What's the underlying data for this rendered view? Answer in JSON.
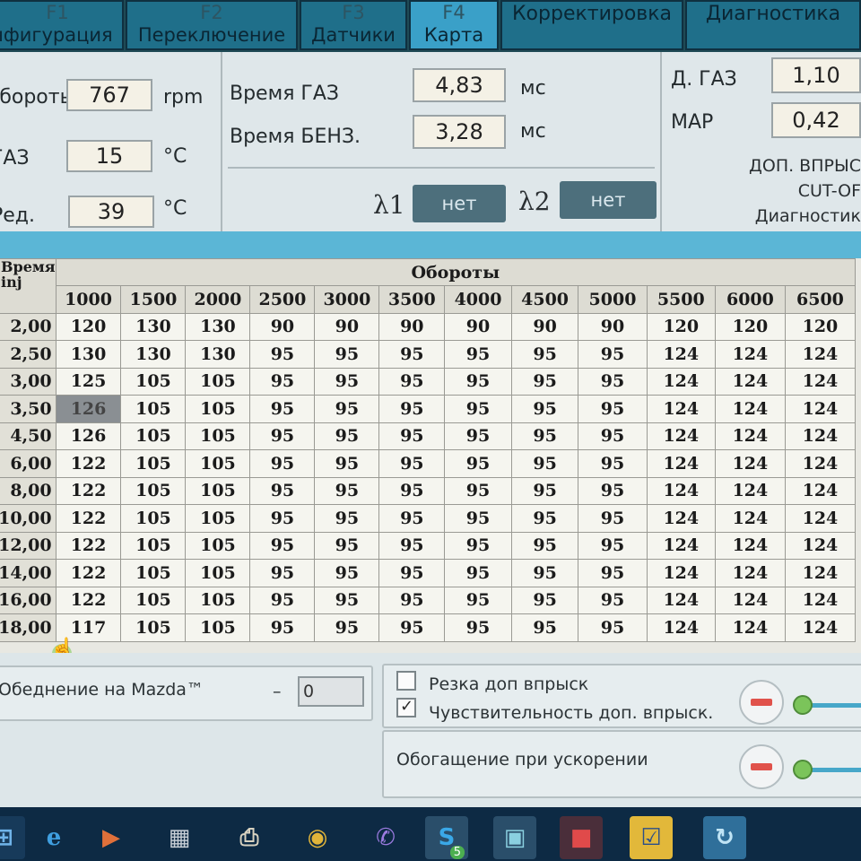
{
  "tabs": [
    {
      "key": "F1",
      "label": "Конфигурация"
    },
    {
      "key": "F2",
      "label": "Переключение"
    },
    {
      "key": "F3",
      "label": "Датчики"
    },
    {
      "key": "F4",
      "label": "Карта"
    },
    {
      "key": "",
      "label": "Корректировка"
    },
    {
      "key": "",
      "label": "Диагностика"
    }
  ],
  "info": {
    "rpm_label": "Обороты",
    "rpm_value": "767",
    "rpm_unit": "rpm",
    "gas_label": "ГАЗ",
    "gas_value": "15",
    "gas_unit": "°C",
    "red_label": "Ред.",
    "red_value": "39",
    "red_unit": "°C",
    "time_gas_label": "Время ГАЗ",
    "time_gas_value": "4,83",
    "time_gas_unit": "мс",
    "time_benz_label": "Время БЕНЗ.",
    "time_benz_value": "3,28",
    "time_benz_unit": "мс",
    "lambda1_label": "λ1",
    "lambda1_value": "нет",
    "lambda2_label": "λ2",
    "lambda2_value": "нет",
    "d_gas_label": "Д. ГАЗ",
    "d_gas_value": "1,10",
    "map_label": "MAP",
    "map_value": "0,42",
    "status_1": "ДОП. ВПРЫС",
    "status_2": "CUT-OF",
    "status_3": "Диагностик"
  },
  "table": {
    "title": "Обороты",
    "corner_1": "Время",
    "corner_2": "inj",
    "columns": [
      "1000",
      "1500",
      "2000",
      "2500",
      "3000",
      "3500",
      "4000",
      "4500",
      "5000",
      "5500",
      "6000",
      "6500"
    ],
    "rows": [
      {
        "label": "2,00",
        "values": [
          "120",
          "130",
          "130",
          "90",
          "90",
          "90",
          "90",
          "90",
          "90",
          "120",
          "120",
          "120"
        ]
      },
      {
        "label": "2,50",
        "values": [
          "130",
          "130",
          "130",
          "95",
          "95",
          "95",
          "95",
          "95",
          "95",
          "124",
          "124",
          "124"
        ]
      },
      {
        "label": "3,00",
        "values": [
          "125",
          "105",
          "105",
          "95",
          "95",
          "95",
          "95",
          "95",
          "95",
          "124",
          "124",
          "124"
        ]
      },
      {
        "label": "3,50",
        "values": [
          "126",
          "105",
          "105",
          "95",
          "95",
          "95",
          "95",
          "95",
          "95",
          "124",
          "124",
          "124"
        ]
      },
      {
        "label": "4,50",
        "values": [
          "126",
          "105",
          "105",
          "95",
          "95",
          "95",
          "95",
          "95",
          "95",
          "124",
          "124",
          "124"
        ]
      },
      {
        "label": "6,00",
        "values": [
          "122",
          "105",
          "105",
          "95",
          "95",
          "95",
          "95",
          "95",
          "95",
          "124",
          "124",
          "124"
        ]
      },
      {
        "label": "8,00",
        "values": [
          "122",
          "105",
          "105",
          "95",
          "95",
          "95",
          "95",
          "95",
          "95",
          "124",
          "124",
          "124"
        ]
      },
      {
        "label": "10,00",
        "values": [
          "122",
          "105",
          "105",
          "95",
          "95",
          "95",
          "95",
          "95",
          "95",
          "124",
          "124",
          "124"
        ]
      },
      {
        "label": "12,00",
        "values": [
          "122",
          "105",
          "105",
          "95",
          "95",
          "95",
          "95",
          "95",
          "95",
          "124",
          "124",
          "124"
        ]
      },
      {
        "label": "14,00",
        "values": [
          "122",
          "105",
          "105",
          "95",
          "95",
          "95",
          "95",
          "95",
          "95",
          "124",
          "124",
          "124"
        ]
      },
      {
        "label": "16,00",
        "values": [
          "122",
          "105",
          "105",
          "95",
          "95",
          "95",
          "95",
          "95",
          "95",
          "124",
          "124",
          "124"
        ]
      },
      {
        "label": "18,00",
        "values": [
          "117",
          "105",
          "105",
          "95",
          "95",
          "95",
          "95",
          "95",
          "95",
          "124",
          "124",
          "124"
        ]
      }
    ],
    "selected": {
      "row": 3,
      "col": 0
    }
  },
  "bottom": {
    "mazda_label": "Обеднение на Mazda™",
    "mazda_dash": "–",
    "mazda_value": "0",
    "cut_label": "Резка доп впрыск",
    "cut_checked": false,
    "sens_label": "Чувствительность доп. впрыск.",
    "sens_checked": true,
    "accel_label": "Обогащение при ускорении"
  },
  "taskbar": {
    "icons": [
      "windows-logo-icon",
      "internet-explorer-icon",
      "media-player-icon",
      "calculator-icon",
      "printer-icon",
      "chrome-icon",
      "viber-icon",
      "skype-icon",
      "remote-desktop-icon",
      "toolbox-icon",
      "task-tool-icon",
      "browser-icon"
    ],
    "skype_badge": "5"
  },
  "colors": {
    "tab_bg": "#1f6f8a",
    "tab_active": "#3aa0c8",
    "panel_bg": "#dfe7ea",
    "strip": "#5bb6d6",
    "lambda_btn": "#4d6f7c",
    "selected_cell": "#8a8f93"
  }
}
